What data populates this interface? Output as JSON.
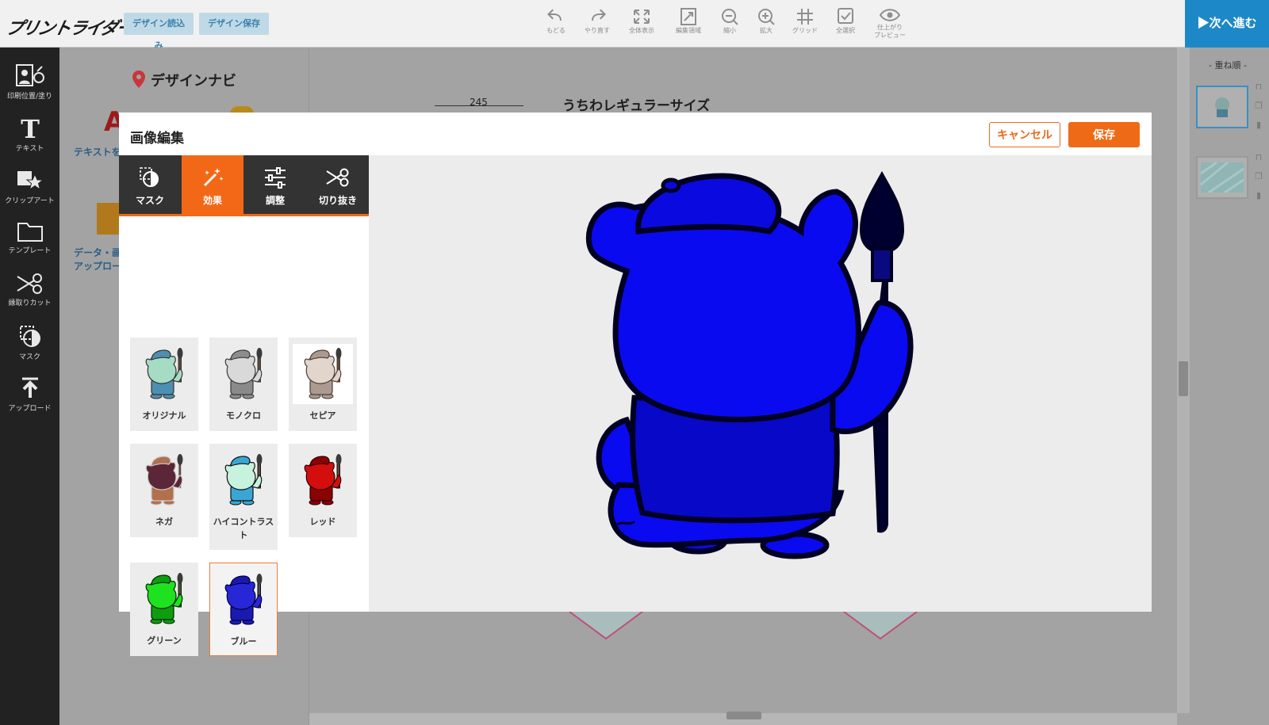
{
  "header": {
    "logo": "プリントライダー",
    "load_label": "デザイン読込み",
    "save_label": "デザイン保存",
    "tools": [
      {
        "label": "もどる",
        "icon": "undo-icon"
      },
      {
        "label": "やり直す",
        "icon": "redo-icon"
      },
      {
        "label": "全体表示",
        "icon": "fit-all-icon"
      },
      {
        "label": "編集領域",
        "icon": "edit-area-icon"
      },
      {
        "label": "縮小",
        "icon": "zoom-out-icon"
      },
      {
        "label": "拡大",
        "icon": "zoom-in-icon"
      },
      {
        "label": "グリッド",
        "icon": "grid-icon"
      },
      {
        "label": "全選択",
        "icon": "select-all-icon"
      },
      {
        "label": "仕上がり",
        "label2": "プレビュー",
        "icon": "preview-eye-icon"
      }
    ],
    "next_label": "▶次へ進む"
  },
  "sidebar": {
    "items": [
      {
        "label": "印刷位置/塗り",
        "icon": "print-position-icon"
      },
      {
        "label": "テキスト",
        "icon": "text-icon"
      },
      {
        "label": "クリップアート",
        "icon": "clipart-star-icon"
      },
      {
        "label": "テンプレート",
        "icon": "template-folder-icon"
      },
      {
        "label": "縁取りカット",
        "icon": "scissors-icon"
      },
      {
        "label": "マスク",
        "icon": "mask-icon"
      },
      {
        "label": "アップロード",
        "icon": "upload-icon"
      }
    ]
  },
  "navi": {
    "title": "デザインナビ",
    "text_link": "テキストを",
    "data_link_1": "データ・画",
    "data_link_2": "アップロー"
  },
  "canvas": {
    "title": "うちわレギュラーサイズ",
    "dimension": "245"
  },
  "layers": {
    "title": "- 重ね順 -"
  },
  "modal": {
    "title": "画像編集",
    "cancel_label": "キャンセル",
    "save_label": "保存",
    "tabs": [
      {
        "label": "マスク",
        "icon": "mask-icon"
      },
      {
        "label": "効果",
        "icon": "magic-wand-icon",
        "active": true
      },
      {
        "label": "調整",
        "icon": "sliders-icon"
      },
      {
        "label": "切り抜き",
        "icon": "scissors-icon"
      }
    ],
    "effects": [
      {
        "label": "オリジナル",
        "body": "#a6dcc4",
        "hat": "#4f8fb0",
        "shirt": "#4d8fb3",
        "outline": "#333333"
      },
      {
        "label": "モノクロ",
        "body": "#d9d9d9",
        "hat": "#8d8d8d",
        "shirt": "#8a8a8a",
        "outline": "#3a3a3a"
      },
      {
        "label": "セピア",
        "body": "#e2d5cc",
        "hat": "#a89a91",
        "shirt": "#aa9a90",
        "outline": "#4d3f36"
      },
      {
        "label": "ネガ",
        "body": "#5a2638",
        "hat": "#b07050",
        "shirt": "#b2704c",
        "outline": "#cccccc"
      },
      {
        "label": "ハイコントラスト",
        "body": "#c7f2dd",
        "hat": "#3aa6d6",
        "shirt": "#3aa6d6",
        "outline": "#111111"
      },
      {
        "label": "レッド",
        "body": "#d40d0d",
        "hat": "#8a0303",
        "shirt": "#8a0303",
        "outline": "#2d0000"
      },
      {
        "label": "グリーン",
        "body": "#1fe21f",
        "hat": "#0d9e0d",
        "shirt": "#0d9e0d",
        "outline": "#002600"
      },
      {
        "label": "ブルー",
        "body": "#2727d8",
        "hat": "#1a1ab0",
        "shirt": "#1a1ab0",
        "outline": "#00003a",
        "selected": true
      }
    ],
    "preview": {
      "fill": "#0a0af0",
      "shirt": "#0808c8",
      "outline": "#000022",
      "brush": "#000030"
    }
  }
}
